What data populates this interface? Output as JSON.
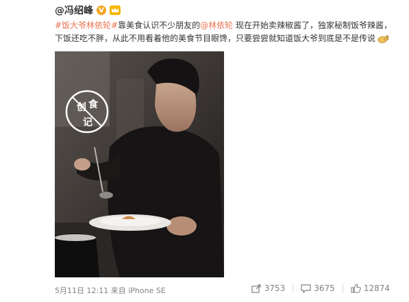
{
  "post": {
    "author": "@冯绍峰",
    "author_badges": {
      "verified_icon": "v-badge",
      "vip_icon": "crown-icon",
      "verified_color": "#f5a623",
      "vip_color": "#f7b500"
    },
    "text_segments": [
      {
        "text": "#饭大爷林依轮#",
        "type": "topic"
      },
      {
        "text": "靠美食认识不少朋友的",
        "type": "plain"
      },
      {
        "text": "@林依轮",
        "type": "mention"
      },
      {
        "text": " 现在开始卖辣椒酱了，独家秘制饭爷辣酱，下饭还吃不胖，从此不用看着他的美食节目眼馋，只要尝尝就知道饭大爷到底是不是传说",
        "type": "plain"
      }
    ],
    "emoji": "sheep-emoji",
    "link_color": "#eb7350",
    "image": {
      "description_icon": "photo",
      "logo_text": [
        "创",
        "食",
        "记"
      ]
    },
    "meta": {
      "date": "5月11日 12:11",
      "source_prefix": "来自",
      "source": "iPhone SE"
    },
    "actions": {
      "share_count": "3753",
      "comment_count": "3675",
      "like_count": "12874"
    }
  }
}
